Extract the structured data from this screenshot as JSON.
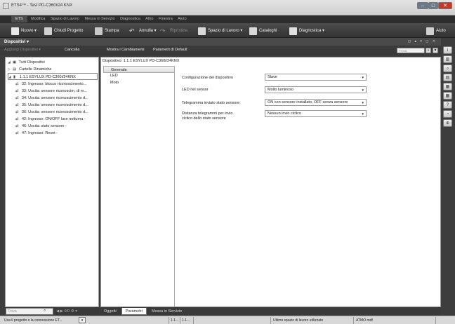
{
  "window": {
    "title": "ETS4™ - Test PD-C360i/24 KNX",
    "controls": [
      "–",
      "□",
      "✕"
    ]
  },
  "menu": {
    "ets": "ETS",
    "items": [
      "Modifica",
      "Spazio di Lavoro",
      "Messa in Servizio",
      "Diagnostica",
      "Altro",
      "Finestra",
      "Aiuto"
    ]
  },
  "toolbar": {
    "nuovo": "Nuovo ▾",
    "chiudi": "Chiudi Progetto",
    "stampa": "Stampa",
    "annulla": "Annulla ▾",
    "ripristina": "Ripristina",
    "spazio": "Spazio di Lavoro ▾",
    "cataloghi": "Cataloghi",
    "diagnostica": "Diagnostica ▾",
    "aiuto": "Aiuto"
  },
  "panel": {
    "title": "Dispositivi ▾",
    "right_controls": "◻ ▴ ▾ ◻ ✕"
  },
  "actions": {
    "aggiungi": "Aggiungi Dispositivi ▾",
    "cancella": "Cancella",
    "mostra": "Mostra i Cambiamenti",
    "parametri": "Parametri di Default",
    "search_placeholder": "Trova"
  },
  "tree": {
    "items": [
      {
        "label": "Tutti Dispositivi",
        "exp": "◢",
        "ico": "▣"
      },
      {
        "label": "Cartelle Dinamiche",
        "exp": "▷",
        "ico": "▤"
      },
      {
        "label": "1.1.1  ESYLUX PD-C360i/24KNX",
        "exp": "◢",
        "ico": "▮"
      },
      {
        "label": "32: Ingresso: blocco riconoscimento...",
        "exp": "",
        "ico": "⇄"
      },
      {
        "label": "33: Uscita: sensore riconoscim, di m...",
        "exp": "",
        "ico": "⇄"
      },
      {
        "label": "34: Uscita: sensore riconoscimento d...",
        "exp": "",
        "ico": "⇄"
      },
      {
        "label": "35: Uscita: sensore riconoscimento d...",
        "exp": "",
        "ico": "⇄"
      },
      {
        "label": "36: Uscita: sensore riconoscimento d...",
        "exp": "",
        "ico": "⇄"
      },
      {
        "label": "42: Ingresso: ON/OFF luce notturna -",
        "exp": "",
        "ico": "⇄"
      },
      {
        "label": "46: Uscita: stato sensore -",
        "exp": "",
        "ico": "⇄"
      },
      {
        "label": "47: Ingresso: Reset -",
        "exp": "",
        "ico": "⇄"
      }
    ],
    "search_placeholder": "Trova",
    "nav": "◀ ▶  0/0  ⚙ ▾"
  },
  "device": {
    "title": "Dispositivo: 1.1.1  ESYLUX PD-C360i/24KNX",
    "nav": [
      "Generale",
      "LED",
      "Moto"
    ],
    "params": [
      {
        "label": "Configurazione del dispositivo",
        "value": "Slave"
      },
      {
        "label": "LED nel sensor",
        "value": "Molto luminoso"
      },
      {
        "label": "Telegramma inviato stato sensore",
        "value": "ON con sensore installato, OFF senza sensore"
      },
      {
        "label": "Distanza telegrammi per invio\nciclico dello stato sensore",
        "value": "Nessun invio ciclico"
      }
    ]
  },
  "tabs": [
    "Oggetti",
    "Parametri",
    "Messa in Servizio"
  ],
  "status": {
    "project": "Usa il progetto o la connessione ET...",
    "addr1": "1.1...",
    "addr2": "1.1...",
    "workspace": "Ultimo spazio di lavoro utilizzato",
    "file": "ATMO.mdf"
  },
  "rightbar": [
    "i",
    "▥",
    "⌕",
    "▤",
    "▦",
    "▦",
    "?",
    "◔",
    "⊕"
  ]
}
